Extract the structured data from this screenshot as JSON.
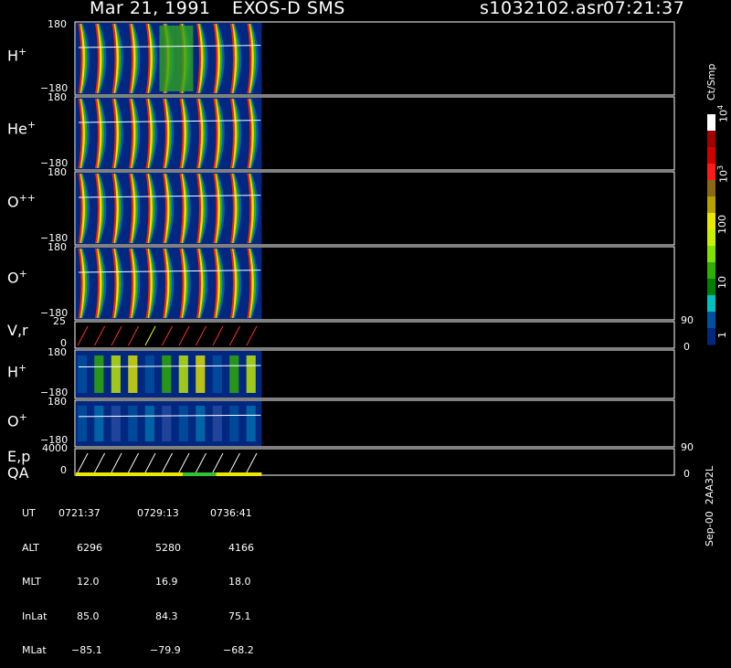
{
  "header": {
    "date": "Mar 21, 1991",
    "instrument": "EXOS-D SMS",
    "file": "s1032102.asr",
    "time": "07:21:37"
  },
  "panels": [
    {
      "label": "H",
      "sup": "+",
      "top": "180",
      "bottom": "−180"
    },
    {
      "label": "He",
      "sup": "+",
      "top": "180",
      "bottom": "−180"
    },
    {
      "label": "O",
      "sup": "++",
      "top": "180",
      "bottom": "−180"
    },
    {
      "label": "O",
      "sup": "+",
      "top": "180",
      "bottom": "−180"
    },
    {
      "label": "V,r",
      "sup": "",
      "top": "25",
      "bottom": "0",
      "rtop": "90",
      "rbottom": "0"
    },
    {
      "label": "H",
      "sup": "+",
      "top": "180",
      "bottom": "−180"
    },
    {
      "label": "O",
      "sup": "+",
      "top": "180",
      "bottom": "−180"
    },
    {
      "label": "E,p",
      "label2": "QA",
      "sup": "",
      "top": "4000",
      "bottom": "0",
      "rtop": "90",
      "rbottom": "0"
    }
  ],
  "colorbar": {
    "unit": "Ct/Smp",
    "ticks": [
      {
        "base": "10",
        "exp": "4"
      },
      {
        "base": "10",
        "exp": "3"
      },
      {
        "base": "100",
        "exp": ""
      },
      {
        "base": "10",
        "exp": ""
      },
      {
        "base": "1",
        "exp": ""
      }
    ],
    "colors": [
      "#ffffff",
      "#a00000",
      "#d00000",
      "#ff1a1a",
      "#8b6914",
      "#b8a000",
      "#e8e800",
      "#c8f000",
      "#80e000",
      "#30b000",
      "#008000",
      "#00c0c0",
      "#0050a0",
      "#002880"
    ]
  },
  "footer_table": {
    "rows": [
      {
        "name": "UT",
        "values": [
          "0721:37",
          "0729:13",
          "0736:41"
        ]
      },
      {
        "name": "ALT",
        "values": [
          "6296",
          "5280",
          "4166"
        ]
      },
      {
        "name": "MLT",
        "values": [
          "12.0",
          "16.9",
          "18.0"
        ]
      },
      {
        "name": "InLat",
        "values": [
          "85.0",
          "84.3",
          "75.1"
        ]
      },
      {
        "name": "MLat",
        "values": [
          "−85.1",
          "−79.9",
          "−68.2"
        ]
      }
    ]
  },
  "side_text": "Sep-00  2AA32L",
  "chart_data": {
    "type": "heatmap",
    "title": "Mar 21, 1991   EXOS-D SMS",
    "file": "s1032102.asr",
    "start_time": "07:21:37",
    "panels": [
      {
        "species": "H+",
        "y_range": [
          -180,
          180
        ],
        "quantity": "pitch angle spectrogram"
      },
      {
        "species": "He+",
        "y_range": [
          -180,
          180
        ],
        "quantity": "pitch angle spectrogram"
      },
      {
        "species": "O++",
        "y_range": [
          -180,
          180
        ],
        "quantity": "pitch angle spectrogram"
      },
      {
        "species": "O+",
        "y_range": [
          -180,
          180
        ],
        "quantity": "pitch angle spectrogram"
      },
      {
        "species": "V,r",
        "y_range": [
          0,
          25
        ],
        "right_range": [
          0,
          90
        ],
        "quantity": "line"
      },
      {
        "species": "H+",
        "y_range": [
          -180,
          180
        ],
        "quantity": "spectrogram"
      },
      {
        "species": "O+",
        "y_range": [
          -180,
          180
        ],
        "quantity": "spectrogram"
      },
      {
        "species": "E,p / QA",
        "y_range": [
          0,
          4000
        ],
        "right_range": [
          0,
          90
        ],
        "quantity": "line"
      }
    ],
    "x_ticks_ut": [
      "0721:37",
      "0729:13",
      "0736:41"
    ],
    "colorbar": {
      "unit": "Ct/Smp",
      "scale": "log",
      "range": [
        1,
        10000
      ]
    },
    "data_extent_fraction": 0.31,
    "sweep_count": 11
  }
}
